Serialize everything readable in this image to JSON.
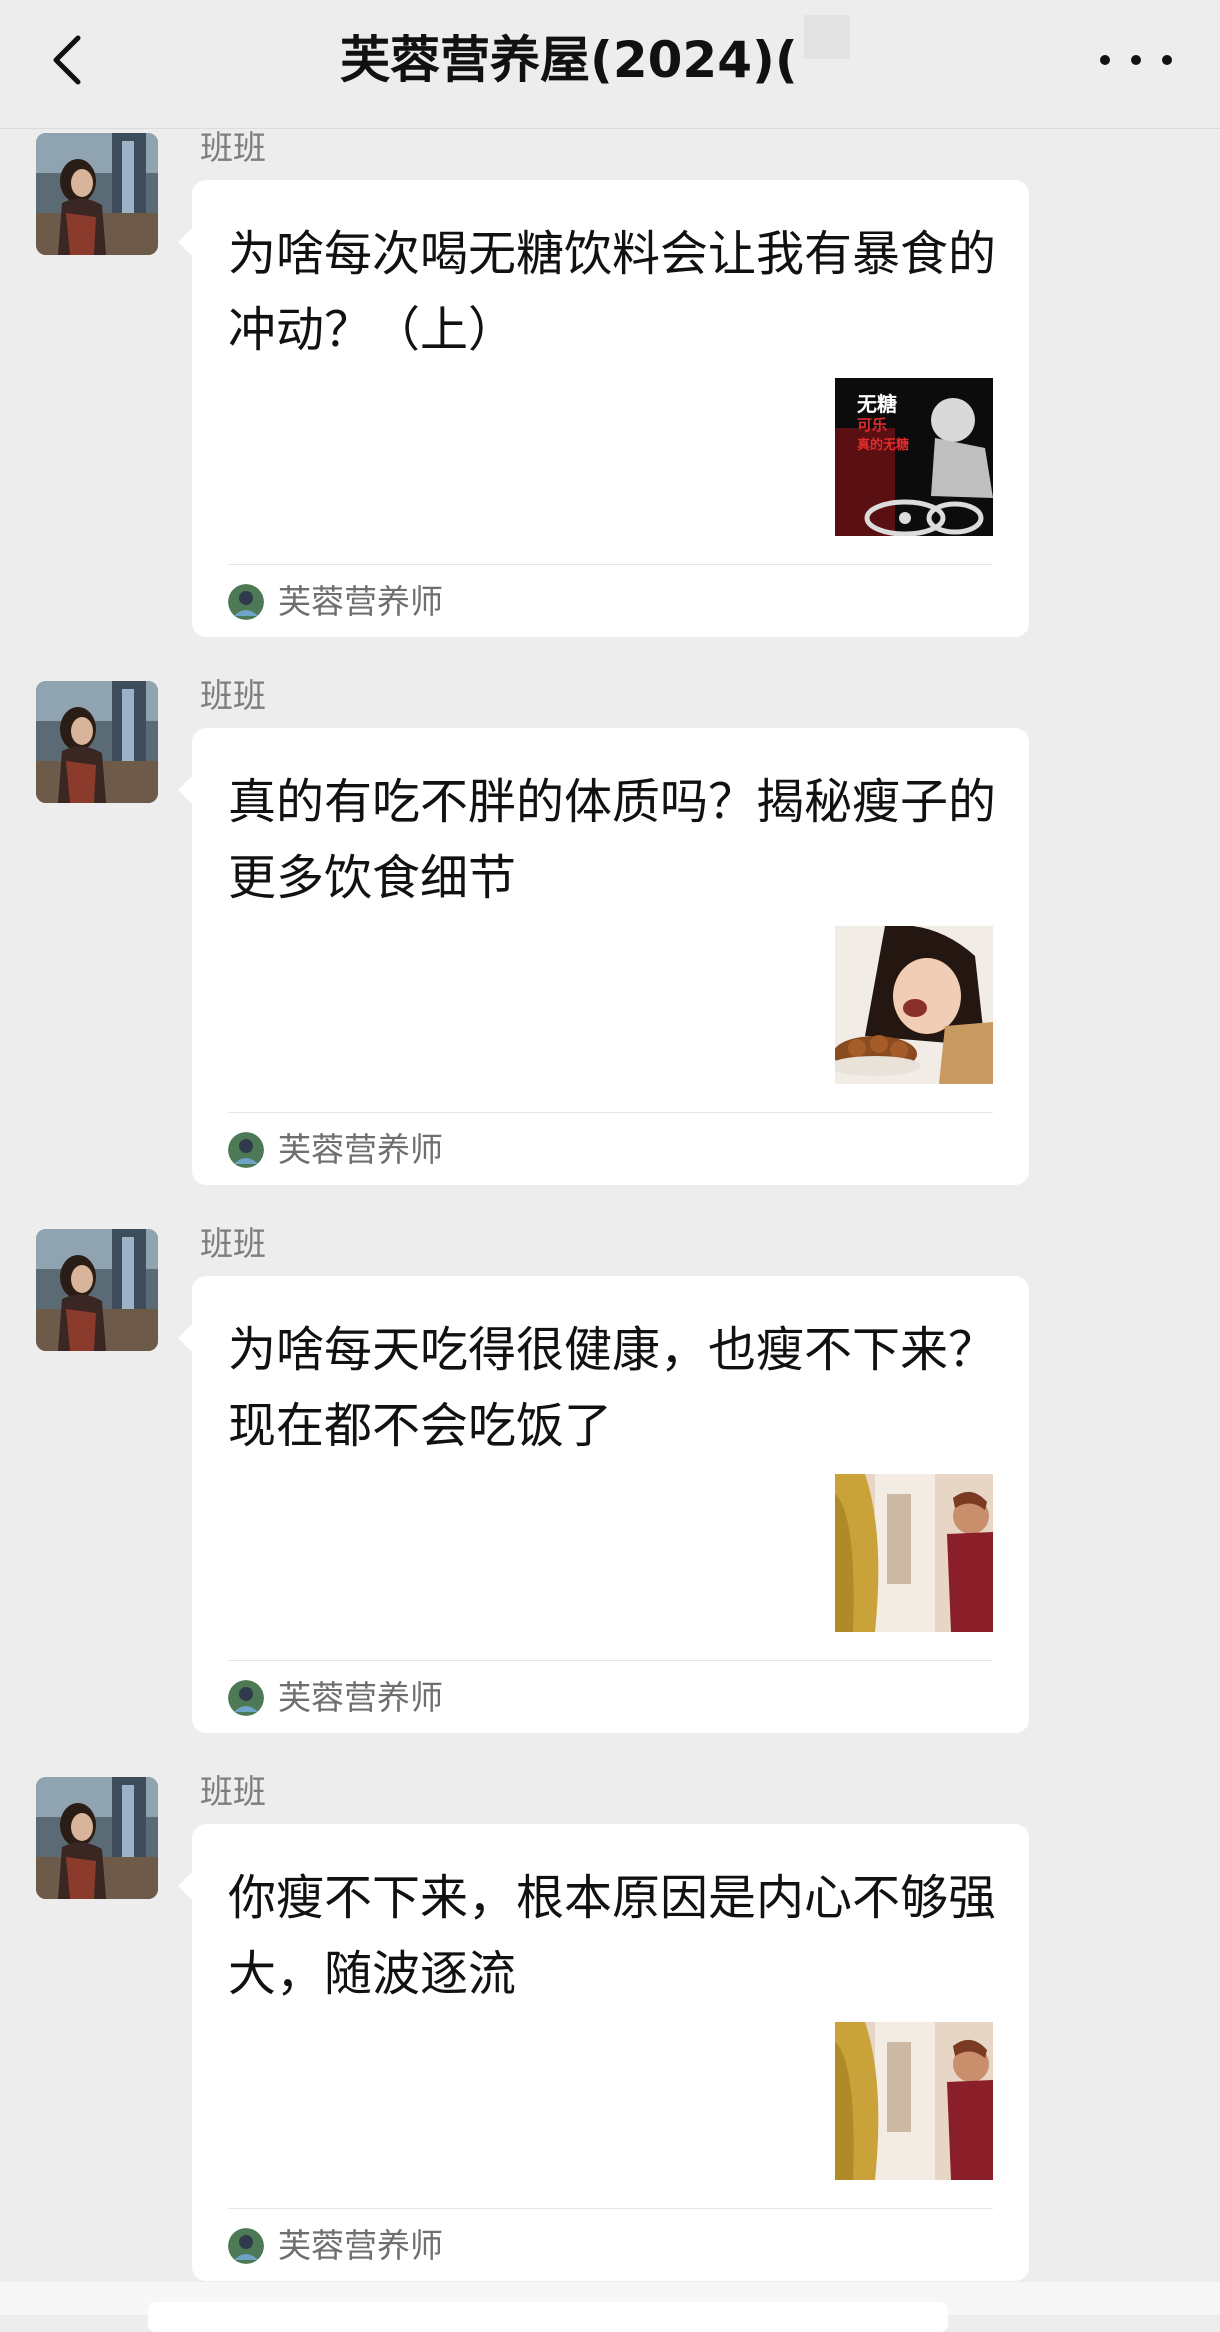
{
  "header": {
    "title": "芙蓉营养屋(2024)(",
    "back_icon": "chevron-left-icon",
    "more_icon": "more-dots-icon"
  },
  "messages": [
    {
      "sender": "班班",
      "card_title": "为啥每次喝无糖饮料会让我有暴食的冲动？（上）",
      "thumb_text": [
        "无糖",
        "可乐",
        "真的无糖"
      ],
      "source_name": "芙蓉营养师"
    },
    {
      "sender": "班班",
      "card_title": "真的有吃不胖的体质吗？揭秘瘦子的更多饮食细节",
      "thumb_text": [],
      "source_name": "芙蓉营养师"
    },
    {
      "sender": "班班",
      "card_title": "为啥每天吃得很健康，也瘦不下来？现在都不会吃饭了",
      "thumb_text": [],
      "source_name": "芙蓉营养师"
    },
    {
      "sender": "班班",
      "card_title": "你瘦不下来，根本原因是内心不够强大，随波逐流",
      "thumb_text": [],
      "source_name": "芙蓉营养师"
    }
  ],
  "colors": {
    "background": "#ededed",
    "bubble": "#ffffff",
    "sender": "#7d7d7d",
    "source": "#6f6f6f"
  }
}
